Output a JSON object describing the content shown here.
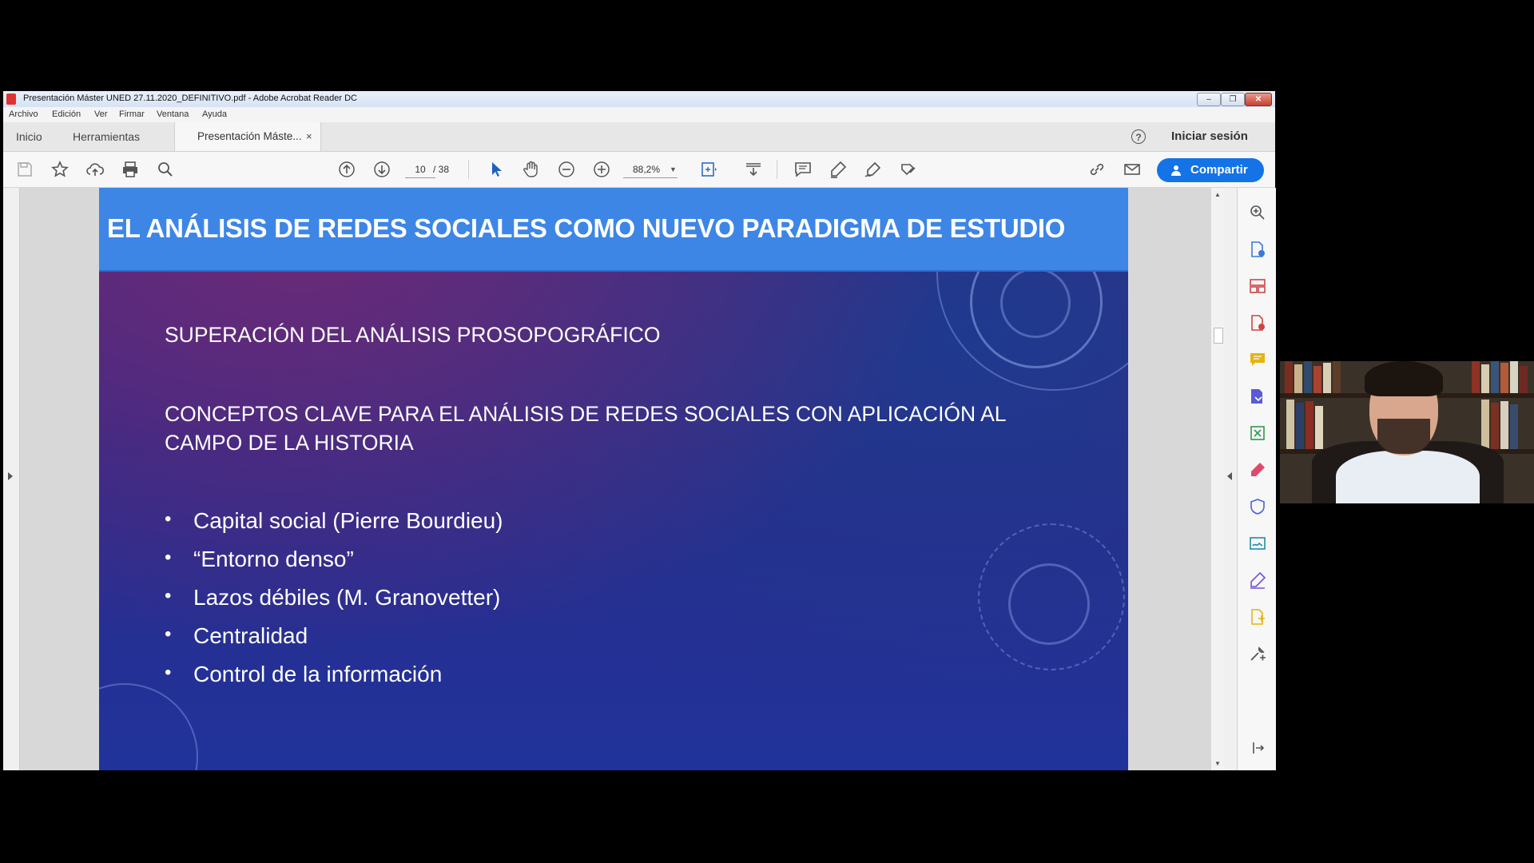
{
  "window": {
    "title": "Presentación Máster UNED 27.11.2020_DEFINITIVO.pdf - Adobe Acrobat Reader DC",
    "controls": {
      "minimize": "–",
      "maximize": "❐",
      "close": "✕"
    }
  },
  "menu": [
    "Archivo",
    "Edición",
    "Ver",
    "Firmar",
    "Ventana",
    "Ayuda"
  ],
  "tabs": {
    "home": "Inicio",
    "tools": "Herramientas",
    "document": "Presentación Máste...",
    "close": "×",
    "help": "?",
    "sign_in": "Iniciar sesión"
  },
  "toolbar": {
    "current_page": "10",
    "page_separator": "/ 38",
    "zoom": "88,2%",
    "share_label": "Compartir",
    "left_icons": [
      "save-icon",
      "bookmark-star-icon",
      "upload-cloud-icon",
      "print-icon",
      "search-icon"
    ],
    "nav_icons": [
      "page-up-icon",
      "page-down-icon"
    ],
    "mode_icons": [
      "select-arrow-icon",
      "hand-icon",
      "zoom-out-icon",
      "zoom-in-icon"
    ],
    "right_icons": [
      "fit-page-icon",
      "scroll-mode-icon",
      "comment-icon",
      "highlight-pen-icon",
      "sign-icon",
      "stamp-icon",
      "link-icon",
      "email-icon"
    ]
  },
  "slide": {
    "title": "EL ANÁLISIS DE REDES SOCIALES COMO NUEVO PARADIGMA DE ESTUDIO",
    "subtitle1": "SUPERACIÓN DEL ANÁLISIS PROSOPOGRÁFICO",
    "subtitle2": "CONCEPTOS CLAVE PARA EL ANÁLISIS DE REDES SOCIALES CON APLICACIÓN AL CAMPO DE LA HISTORIA",
    "bullet_char": "•",
    "bullets": [
      "Capital social (Pierre Bourdieu)",
      "“Entorno denso”",
      "Lazos débiles (M. Granovetter)",
      "Centralidad",
      "Control de la información"
    ],
    "colors": {
      "header": "#3d86e6",
      "bg_top": "#4b2a7e",
      "bg_bottom": "#20339a"
    }
  },
  "right_panel_icons": [
    "zoom-in-icon",
    "create-pdf-icon",
    "organize-pages-icon",
    "export-pdf-icon",
    "comment-icon",
    "combine-files-icon",
    "export-excel-icon",
    "edit-pdf-icon",
    "protect-shield-icon",
    "send-for-signature-icon",
    "fill-sign-icon",
    "more-tools-icon",
    "customize-tools-icon",
    "collapse-panel-icon"
  ],
  "accent_color": "#1473e6"
}
